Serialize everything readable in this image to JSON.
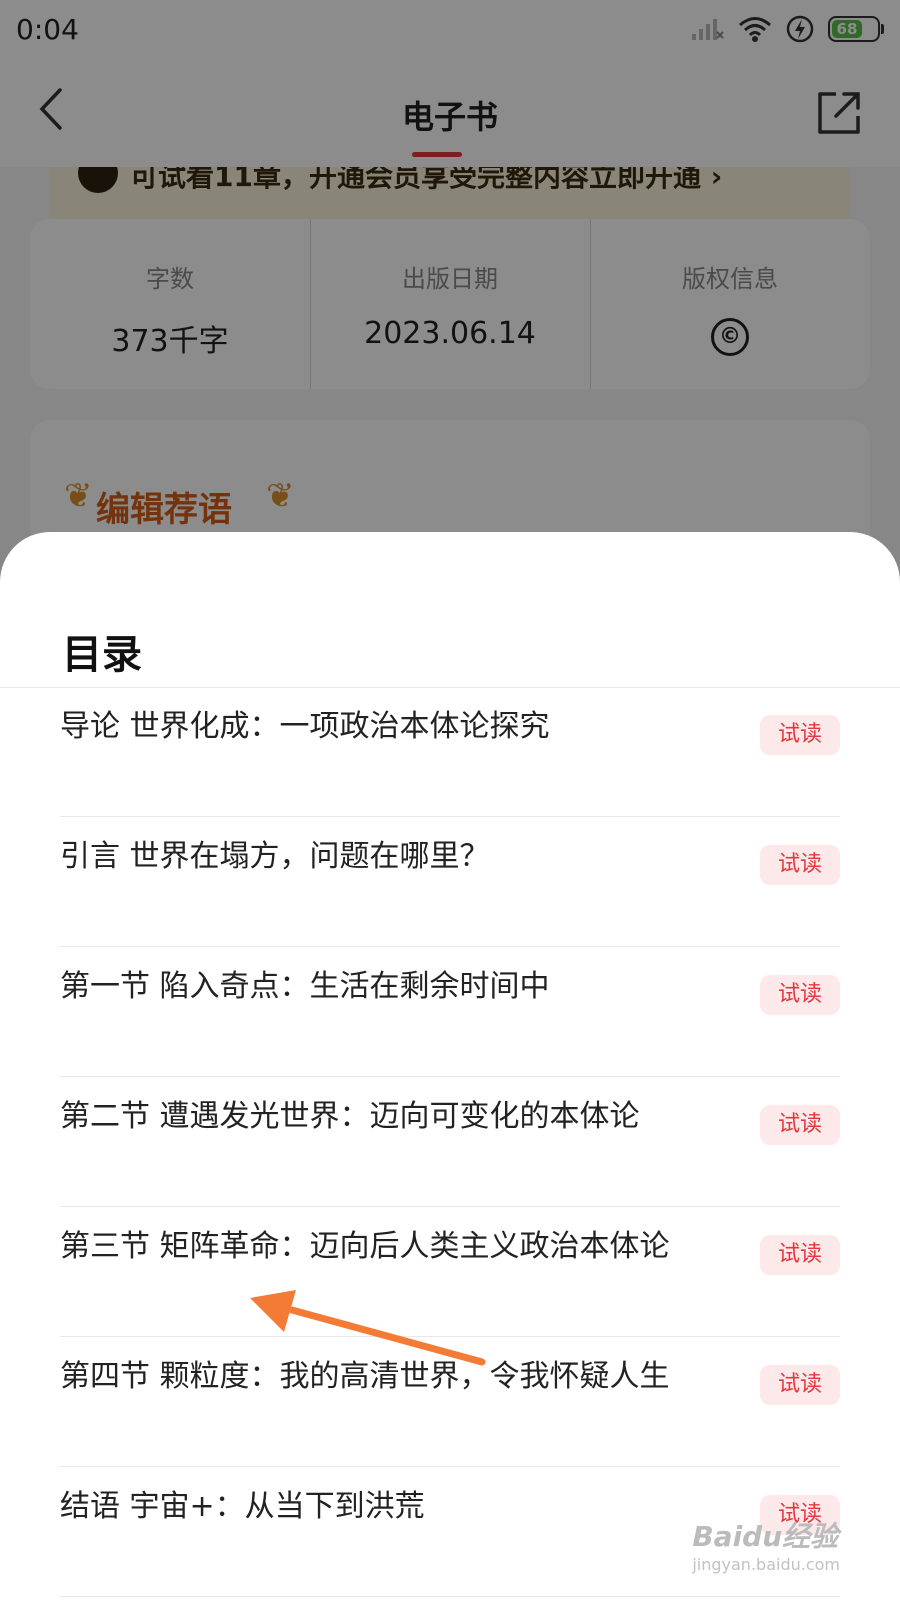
{
  "status_bar": {
    "time": "0:04",
    "battery_level": "68",
    "battery_fraction": 0.68,
    "icons": [
      "signal-icon",
      "wifi-icon",
      "charging-icon",
      "battery-icon"
    ]
  },
  "header": {
    "title": "电子书",
    "back_icon": "back-chevron-icon",
    "share_icon": "share-icon",
    "accent_color": "#e23a3a"
  },
  "promo_banner": {
    "text": "可试看11章，开通会员享受完整内容立即开通 ›"
  },
  "stats": [
    {
      "label": "字数",
      "value": "373千字"
    },
    {
      "label": "出版日期",
      "value": "2023.06.14"
    },
    {
      "label": "版权信息",
      "value": "©"
    }
  ],
  "editor_section": {
    "heading": "编辑荐语"
  },
  "toc": {
    "title": "目录",
    "items": [
      {
        "title": "导论 世界化成：一项政治本体论探究",
        "tag": "试读"
      },
      {
        "title": "引言 世界在塌方，问题在哪里？",
        "tag": "试读"
      },
      {
        "title": "第一节 陷入奇点：生活在剩余时间中",
        "tag": "试读"
      },
      {
        "title": "第二节 遭遇发光世界：迈向可变化的本体论",
        "tag": "试读"
      },
      {
        "title": "第三节 矩阵革命：迈向后人类主义政治本体论",
        "tag": "试读"
      },
      {
        "title": "第四节 颗粒度：我的高清世界，令我怀疑人生",
        "tag": "试读"
      },
      {
        "title": "结语 宇宙+：从当下到洪荒",
        "tag": "试读"
      }
    ]
  },
  "watermark": {
    "brand": "Baidu经验",
    "url": "jingyan.baidu.com"
  },
  "colors": {
    "tag_bg": "#fde9ea",
    "tag_text": "#e2373c",
    "arrow": "#f47b36"
  }
}
